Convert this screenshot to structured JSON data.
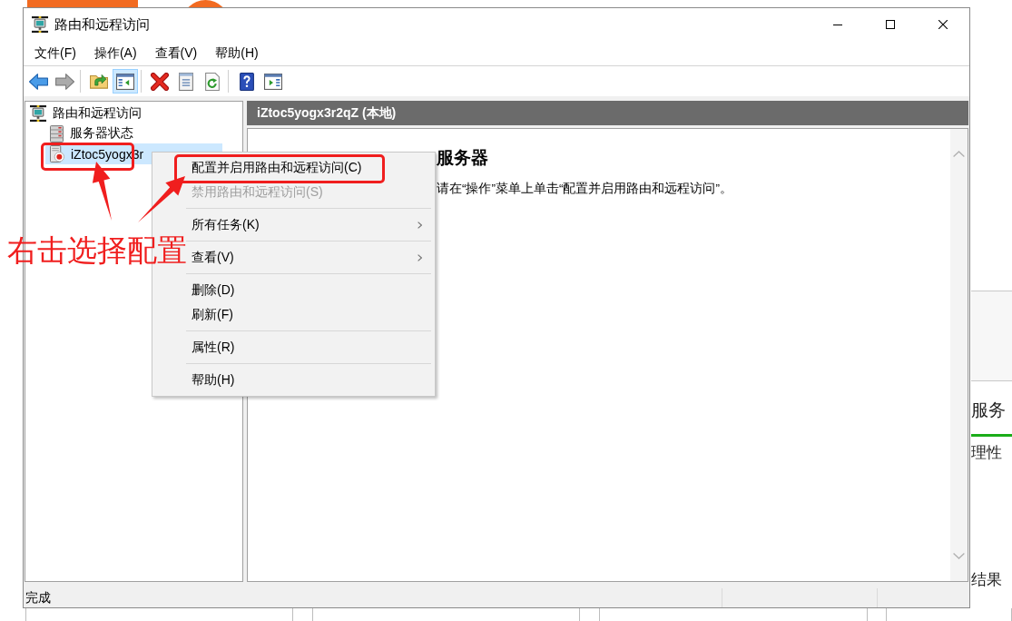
{
  "background": {
    "side_panel": [
      {
        "kind": "heading",
        "text": "服务"
      },
      {
        "kind": "line",
        "text": "理性"
      },
      {
        "kind": "line",
        "text": "结果"
      }
    ]
  },
  "window": {
    "title": "路由和远程访问"
  },
  "menu_bar": [
    "文件(F)",
    "操作(A)",
    "查看(V)",
    "帮助(H)"
  ],
  "toolbar": [
    {
      "kind": "back",
      "disabled": false,
      "pressed": false
    },
    {
      "kind": "forward",
      "disabled": true,
      "pressed": false
    },
    {
      "kind": "separator"
    },
    {
      "kind": "up",
      "disabled": false,
      "pressed": false
    },
    {
      "kind": "console_tree",
      "disabled": false,
      "pressed": true
    },
    {
      "kind": "separator"
    },
    {
      "kind": "delete",
      "disabled": false,
      "pressed": false
    },
    {
      "kind": "properties",
      "disabled": false,
      "pressed": false
    },
    {
      "kind": "refresh",
      "disabled": false,
      "pressed": false
    },
    {
      "kind": "separator"
    },
    {
      "kind": "help",
      "disabled": false,
      "pressed": false
    },
    {
      "kind": "action_pane",
      "disabled": false,
      "pressed": false
    }
  ],
  "tree": [
    {
      "label": "路由和远程访问",
      "kind": "root",
      "selected": false,
      "children": [
        {
          "label": "服务器状态",
          "kind": "status",
          "selected": false
        },
        {
          "label": "iZtoc5yogx3r",
          "kind": "server",
          "selected": true
        }
      ]
    }
  ],
  "details": {
    "header": "iZtoc5yogx3r2qZ (本地)",
    "heading": "服务器",
    "text": "请在“操作”菜单上单击“配置并启用路由和远程访问”。"
  },
  "context_menu": {
    "items": [
      {
        "kind": "item",
        "label": "配置并启用路由和远程访问(C)",
        "disabled": false,
        "submenu": false
      },
      {
        "kind": "item",
        "label": "禁用路由和远程访问(S)",
        "disabled": true,
        "submenu": false
      },
      {
        "kind": "separator"
      },
      {
        "kind": "item",
        "label": "所有任务(K)",
        "disabled": false,
        "submenu": true
      },
      {
        "kind": "separator"
      },
      {
        "kind": "item",
        "label": "查看(V)",
        "disabled": false,
        "submenu": true
      },
      {
        "kind": "separator"
      },
      {
        "kind": "item",
        "label": "删除(D)",
        "disabled": false,
        "submenu": false
      },
      {
        "kind": "item",
        "label": "刷新(F)",
        "disabled": false,
        "submenu": false
      },
      {
        "kind": "separator"
      },
      {
        "kind": "item",
        "label": "属性(R)",
        "disabled": false,
        "submenu": false
      },
      {
        "kind": "separator"
      },
      {
        "kind": "item",
        "label": "帮助(H)",
        "disabled": false,
        "submenu": false
      }
    ]
  },
  "annotation": {
    "label": "右击选择配置"
  },
  "status_bar": {
    "text": "完成"
  }
}
